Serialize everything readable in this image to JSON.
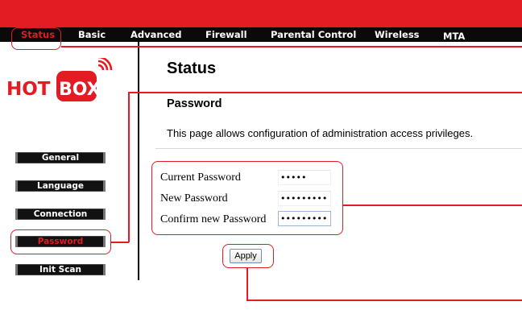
{
  "nav": {
    "items": [
      {
        "label": "Status",
        "active": true
      },
      {
        "label": "Basic",
        "active": false
      },
      {
        "label": "Advanced",
        "active": false
      },
      {
        "label": "Firewall",
        "active": false
      },
      {
        "label": "Parental Control",
        "active": false
      },
      {
        "label": "Wireless",
        "active": false
      },
      {
        "label": "MTA",
        "active": false
      }
    ]
  },
  "logo": {
    "text_hot": "HOT",
    "text_box": "BOX",
    "name": "hotbox-logo"
  },
  "sidebar": {
    "items": [
      {
        "label": "General",
        "active": false
      },
      {
        "label": "Language",
        "active": false
      },
      {
        "label": "Connection",
        "active": false
      },
      {
        "label": "Password",
        "active": true
      },
      {
        "label": "Init Scan",
        "active": false
      }
    ]
  },
  "main": {
    "title": "Status",
    "section": "Password",
    "description": "This page allows configuration of administration access privileges.",
    "form": {
      "fields": [
        {
          "label": "Current Password",
          "value": "•••••"
        },
        {
          "label": "New Password",
          "value": "•••••••••"
        },
        {
          "label": "Confirm new Password",
          "value": "•••••••••"
        }
      ],
      "apply_label": "Apply"
    }
  },
  "colors": {
    "brand_red": "#e31b23",
    "nav_bg": "#0a0a0a"
  }
}
